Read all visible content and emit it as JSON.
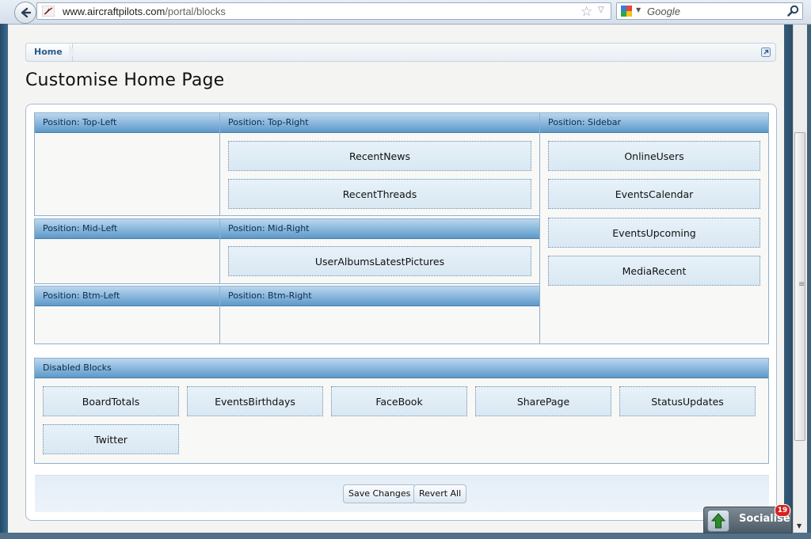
{
  "browser": {
    "url_domain": "www.aircraftpilots.com",
    "url_path": "/portal/blocks",
    "search_placeholder": "Google"
  },
  "breadcrumb": {
    "home": "Home"
  },
  "page_title": "Customise Home Page",
  "positions": {
    "top_left": {
      "label": "Position: Top-Left",
      "blocks": []
    },
    "top_right": {
      "label": "Position: Top-Right",
      "blocks": [
        "RecentNews",
        "RecentThreads"
      ]
    },
    "mid_left": {
      "label": "Position: Mid-Left",
      "blocks": []
    },
    "mid_right": {
      "label": "Position: Mid-Right",
      "blocks": [
        "UserAlbumsLatestPictures"
      ]
    },
    "btm_left": {
      "label": "Position: Btm-Left",
      "blocks": []
    },
    "btm_right": {
      "label": "Position: Btm-Right",
      "blocks": []
    },
    "sidebar": {
      "label": "Position: Sidebar",
      "blocks": [
        "OnlineUsers",
        "EventsCalendar",
        "EventsUpcoming",
        "MediaRecent"
      ]
    },
    "disabled": {
      "label": "Disabled Blocks",
      "blocks": [
        "BoardTotals",
        "EventsBirthdays",
        "FaceBook",
        "SharePage",
        "StatusUpdates",
        "Twitter"
      ]
    }
  },
  "footer": {
    "save_label": "Save Changes",
    "revert_label": "Revert All"
  },
  "socialise": {
    "label": "Socialise",
    "badge_count": "19"
  }
}
